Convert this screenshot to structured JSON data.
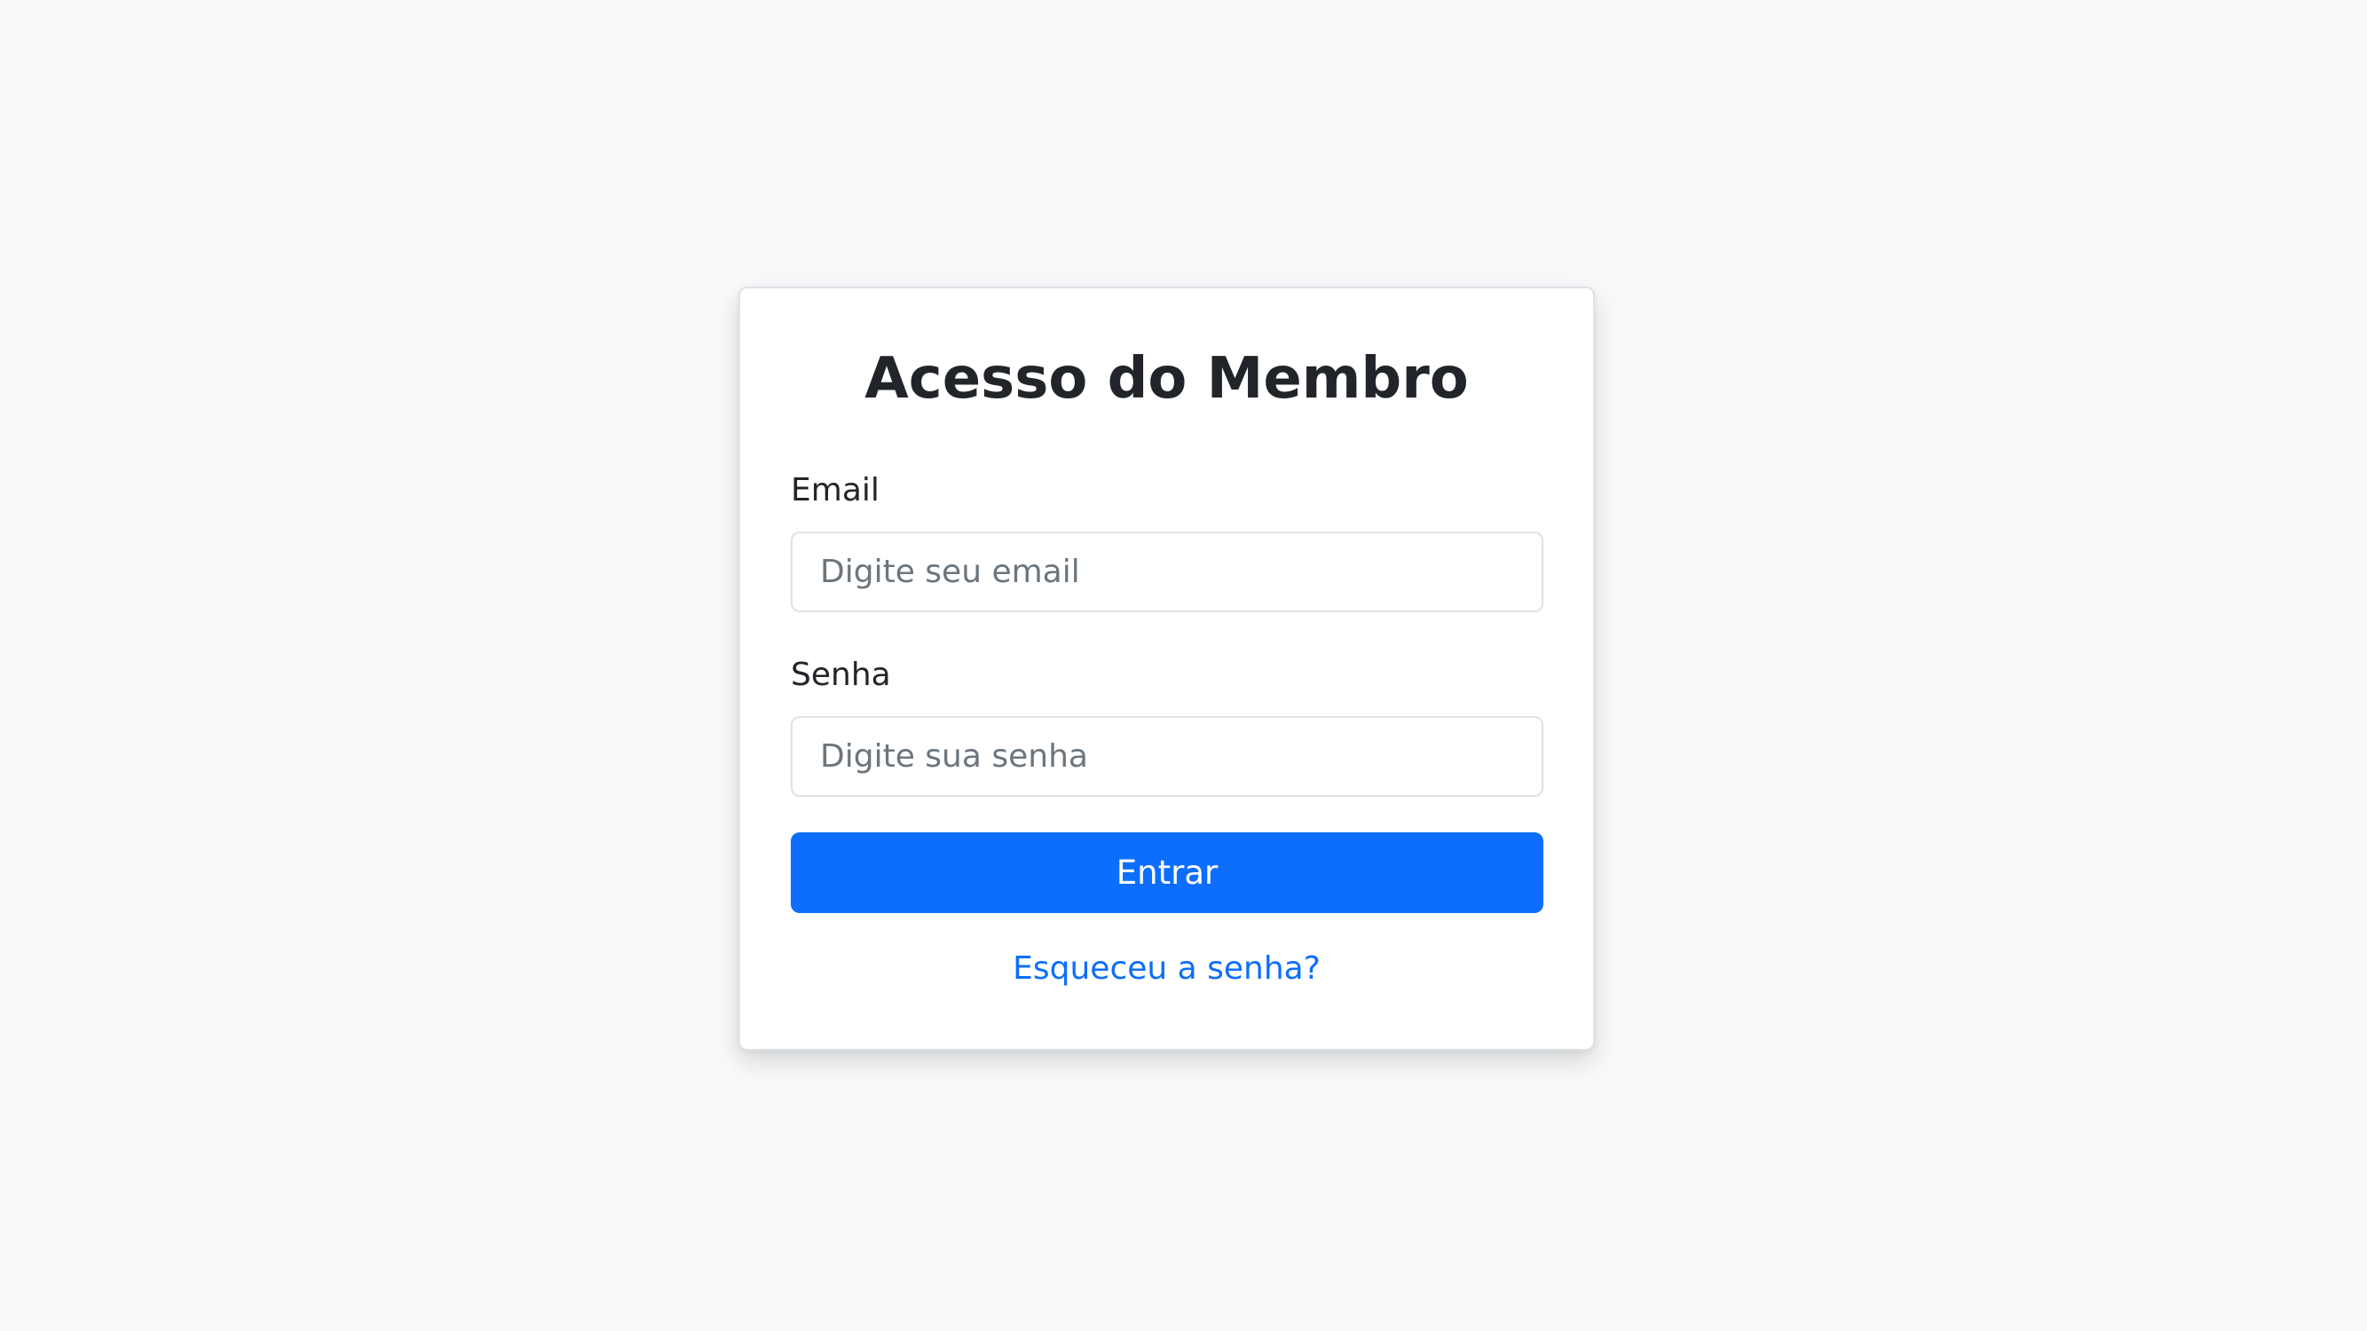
{
  "login": {
    "title": "Acesso do Membro",
    "email_label": "Email",
    "email_placeholder": "Digite seu email",
    "password_label": "Senha",
    "password_placeholder": "Digite sua senha",
    "submit_label": "Entrar",
    "forgot_password_label": "Esqueceu a senha?"
  },
  "colors": {
    "page_background": "#f8f9fa",
    "primary": "#0d6efd",
    "text": "#212529"
  }
}
